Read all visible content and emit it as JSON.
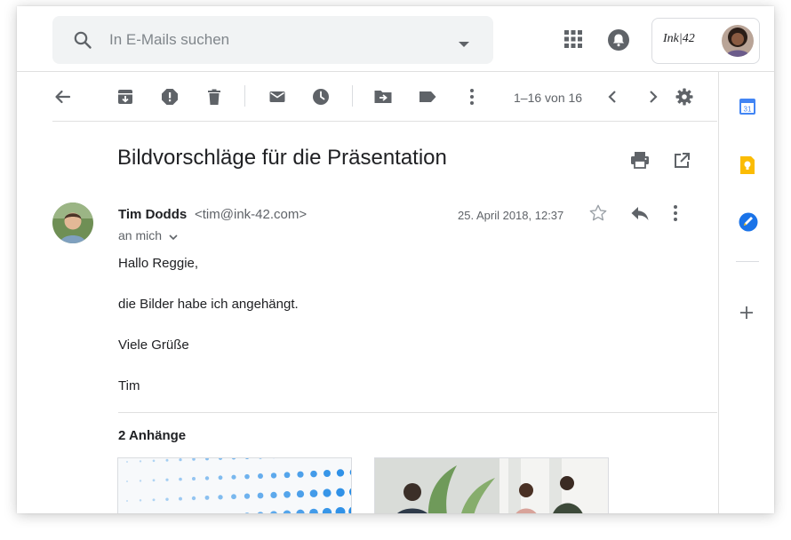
{
  "search": {
    "placeholder": "In E-Mails suchen"
  },
  "account": {
    "brand": "Ink|42"
  },
  "toolbar": {
    "pager": "1–16 von 16"
  },
  "email": {
    "subject": "Bildvorschläge für die Präsentation",
    "sender_name": "Tim Dodds",
    "sender_email": "<tim@ink-42.com>",
    "recipient": "an mich",
    "date": "25. April 2018, 12:37",
    "body": [
      "Hallo Reggie,",
      "die Bilder habe ich angehängt.",
      "Viele Grüße",
      "Tim"
    ],
    "attachments_title": "2 Anhänge"
  },
  "icons": {
    "search": "search-icon",
    "dropdown": "caret-down-icon",
    "apps": "apps-grid-icon",
    "notifications": "bell-icon",
    "back": "arrow-back-icon",
    "archive": "archive-icon",
    "spam": "report-spam-icon",
    "delete": "trash-icon",
    "unread": "mail-icon",
    "snooze": "clock-icon",
    "move": "move-to-folder-icon",
    "label": "label-icon",
    "more": "more-vert-icon",
    "prev": "chevron-left-icon",
    "next": "chevron-right-icon",
    "settings": "gear-icon",
    "print": "print-icon",
    "popout": "open-in-new-icon",
    "star": "star-outline-icon",
    "reply": "reply-icon",
    "calendar": "calendar-icon",
    "keep": "keep-bulb-icon",
    "tasks": "tasks-icon",
    "add": "plus-icon"
  },
  "colors": {
    "icon": "#5f6368",
    "text": "#202124",
    "secondary": "#5f6368",
    "calendar": "#4285f4",
    "keep": "#fbbc04",
    "tasks": "#1a73e8"
  }
}
